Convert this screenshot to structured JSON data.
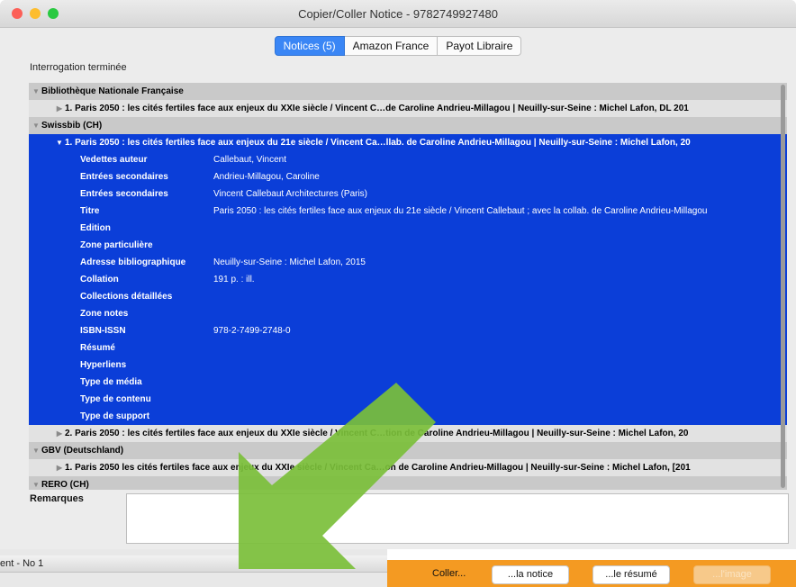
{
  "window": {
    "title": "Copier/Coller Notice - 9782749927480",
    "traffic_colors": [
      "#fc5f57",
      "#fdbd2e",
      "#29c941"
    ]
  },
  "tabs": [
    {
      "label": "Notices (5)",
      "active": true
    },
    {
      "label": "Amazon France",
      "active": false
    },
    {
      "label": "Payot Libraire",
      "active": false
    }
  ],
  "status": "Interrogation terminée",
  "rows": [
    {
      "type": "group",
      "tri": "▼",
      "text": "Bibliothèque Nationale Française"
    },
    {
      "type": "item",
      "tri": "▶",
      "text": "1. Paris 2050 : les cités fertiles face aux enjeux du XXIe siècle / Vincent C…de Caroline Andrieu-Millagou | Neuilly-sur-Seine : Michel Lafon, DL 201"
    },
    {
      "type": "group",
      "tri": "▼",
      "text": "Swissbib (CH)"
    },
    {
      "type": "sel-head",
      "tri": "▼",
      "text": "1. Paris 2050 : les cités fertiles face aux enjeux du 21e siècle / Vincent Ca…llab. de Caroline Andrieu-Millagou | Neuilly-sur-Seine : Michel Lafon, 20"
    },
    {
      "type": "field",
      "name": "Vedettes auteur",
      "value": "Callebaut, Vincent"
    },
    {
      "type": "field",
      "name": "Entrées secondaires",
      "value": "Andrieu-Millagou, Caroline"
    },
    {
      "type": "field",
      "name": "Entrées secondaires",
      "value": "Vincent Callebaut Architectures (Paris)"
    },
    {
      "type": "field",
      "name": "Titre",
      "value": "Paris 2050 : les cités fertiles face aux enjeux du 21e siècle / Vincent Callebaut ; avec la collab. de Caroline Andrieu-Millagou"
    },
    {
      "type": "field",
      "name": "Edition",
      "value": ""
    },
    {
      "type": "field",
      "name": "Zone particulière",
      "value": ""
    },
    {
      "type": "field",
      "name": "Adresse bibliographique",
      "value": "Neuilly-sur-Seine : Michel Lafon, 2015"
    },
    {
      "type": "field",
      "name": "Collation",
      "value": "191 p. : ill."
    },
    {
      "type": "field",
      "name": "Collections détaillées",
      "value": ""
    },
    {
      "type": "field",
      "name": "Zone notes",
      "value": ""
    },
    {
      "type": "field",
      "name": "ISBN-ISSN",
      "value": "978-2-7499-2748-0"
    },
    {
      "type": "field",
      "name": "Résumé",
      "value": ""
    },
    {
      "type": "field",
      "name": "Hyperliens",
      "value": ""
    },
    {
      "type": "field",
      "name": "Type de média",
      "value": ""
    },
    {
      "type": "field",
      "name": "Type de contenu",
      "value": ""
    },
    {
      "type": "field",
      "name": "Type de support",
      "value": ""
    },
    {
      "type": "item",
      "tri": "▶",
      "text": "2. Paris 2050 : les cités fertiles face aux enjeux du XXIe siècle / Vincent C…tion de Caroline Andrieu-Millagou | Neuilly-sur-Seine : Michel Lafon, 20"
    },
    {
      "type": "group",
      "tri": "▼",
      "text": "GBV (Deutschland)"
    },
    {
      "type": "item",
      "tri": "▶",
      "text": "1. Paris 2050 les cités fertiles face aux enjeux du XXIe siècle / Vincent Ca…on de Caroline Andrieu-Millagou | Neuilly-sur-Seine : Michel Lafon, [201"
    },
    {
      "type": "group",
      "tri": "▼",
      "text": "RERO (CH)"
    }
  ],
  "remarques_label": "Remarques",
  "doc_window_title": "ent - No 1",
  "paste_bar": {
    "label": "Coller...",
    "buttons": [
      {
        "label": "...la notice",
        "enabled": true
      },
      {
        "label": "...le résumé",
        "enabled": true
      },
      {
        "label": "...l'image",
        "enabled": false
      }
    ]
  },
  "colors": {
    "selection": "#0b3ed8",
    "group_row": "#c9c9c9",
    "item_row": "#e2e2e2",
    "paste_bar": "#f49a22",
    "arrow": "#7bbf3a"
  }
}
